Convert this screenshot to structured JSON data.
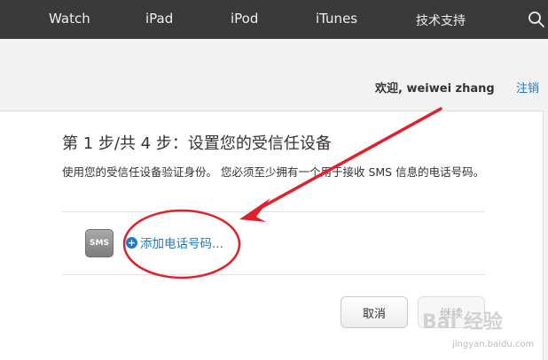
{
  "nav": {
    "items": [
      "Watch",
      "iPad",
      "iPod",
      "iTunes",
      "技术支持"
    ]
  },
  "account": {
    "welcome": "欢迎, weiwei zhang",
    "logout": "注销"
  },
  "step": {
    "title": "第 1 步/共 4 步：设置您的受信任设备",
    "description": "使用您的受信任设备验证身份。 您必须至少拥有一个用于接收 SMS 信息的电话号码。"
  },
  "device": {
    "sms_badge": "SMS",
    "add_phone": "添加电话号码..."
  },
  "buttons": {
    "cancel": "取消",
    "continue": "继续"
  },
  "watermark": {
    "brand": "Bai 经验",
    "url": "jingyan.baidu.com"
  },
  "colors": {
    "nav_bg": "#3a3a3a",
    "link": "#1a7ac4",
    "annotation": "#e0202a"
  }
}
